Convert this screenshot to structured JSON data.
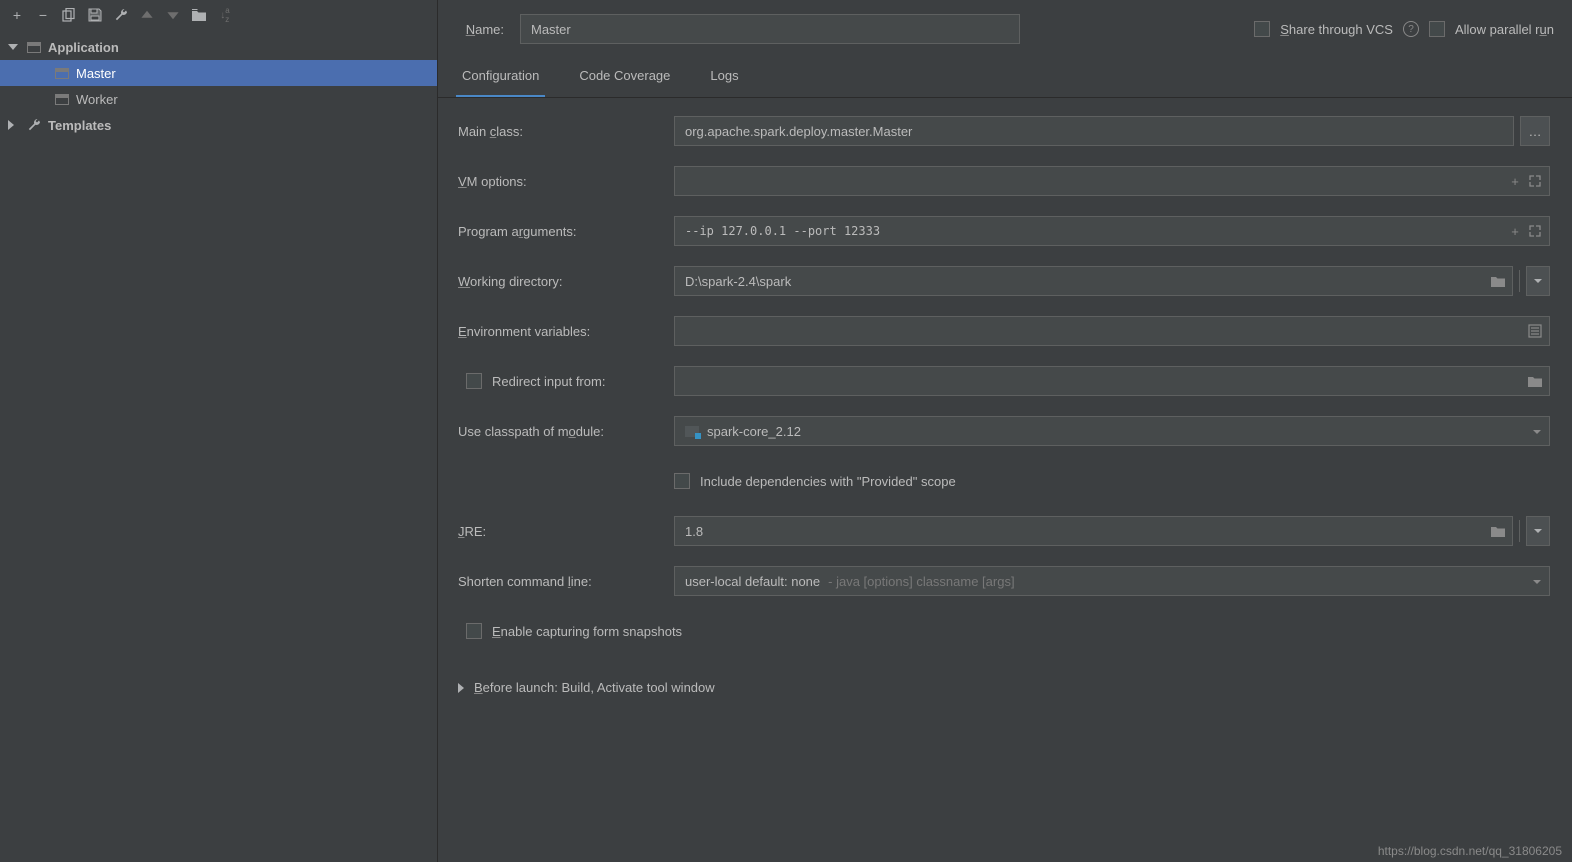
{
  "toolbar": {
    "add": "+",
    "remove": "−"
  },
  "sidebar": {
    "application_label": "Application",
    "master_label": "Master",
    "worker_label": "Worker",
    "templates_label": "Templates"
  },
  "header": {
    "name_label": "Name:",
    "name_value": "Master",
    "share_label_pre": "S",
    "share_label_post": "hare through VCS",
    "allow_label_pre": "Allow parallel r",
    "allow_label_u": "u",
    "allow_label_post": "n"
  },
  "tabs": {
    "configuration": "Configuration",
    "code_coverage": "Code Coverage",
    "logs": "Logs"
  },
  "form": {
    "main_class_label_pre": "Main ",
    "main_class_label_u": "c",
    "main_class_label_post": "lass:",
    "main_class_value": "org.apache.spark.deploy.master.Master",
    "vm_options_label_u": "V",
    "vm_options_label_post": "M options:",
    "vm_options_value": "",
    "program_args_label_pre": "Program a",
    "program_args_label_u": "r",
    "program_args_label_post": "guments:",
    "program_args_value": "--ip 127.0.0.1 --port 12333",
    "working_dir_label_u": "W",
    "working_dir_label_post": "orking directory:",
    "working_dir_value": "D:\\spark-2.4\\spark",
    "env_vars_label_u": "E",
    "env_vars_label_post": "nvironment variables:",
    "env_vars_value": "",
    "redirect_label": "Redirect input from:",
    "classpath_label_pre": "Use classpath of m",
    "classpath_label_u": "o",
    "classpath_label_post": "dule:",
    "classpath_value": "spark-core_2.12",
    "include_deps_label": "Include dependencies with \"Provided\" scope",
    "jre_label_u": "J",
    "jre_label_post": "RE:",
    "jre_value": "1.8",
    "shorten_label_pre": "Shorten command ",
    "shorten_label_u": "l",
    "shorten_label_post": "ine:",
    "shorten_value_main": "user-local default: none",
    "shorten_value_hint": " - java [options] classname [args]",
    "enable_capture_pre": "E",
    "enable_capture_post": "nable capturing form snapshots"
  },
  "before_launch": {
    "label_pre": "B",
    "label_post": "efore launch: Build, Activate tool window"
  },
  "footer": {
    "watermark": "https://blog.csdn.net/qq_31806205"
  }
}
